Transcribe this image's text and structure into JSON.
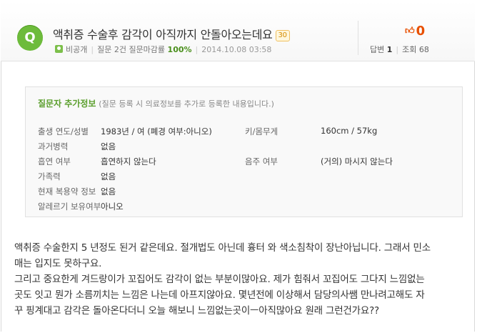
{
  "question": {
    "badge": "Q",
    "title": "액취증 수술후 감각이 아직까지 안돌아오는데요",
    "points": "30",
    "author": "비공개",
    "stats_text": "질문 2건 질문마감률",
    "close_rate": "100%",
    "date": "2014.10.08 03:58"
  },
  "stats": {
    "like_count": "0",
    "answers_label": "답변",
    "answers": "1",
    "views_label": "조회",
    "views": "68"
  },
  "info": {
    "title": "질문자 추가정보",
    "title_desc": "(질문 등록 시 의료정보를 추가로 등록한 내용입니다.)",
    "rows": [
      {
        "label": "출생 연도/성별",
        "value": "1983년 / 여 (폐경 여부:아니오)",
        "label2": "키/몸무게",
        "value2": "160cm / 57kg"
      },
      {
        "label": "과거병력",
        "value": "없음",
        "label2": "",
        "value2": ""
      },
      {
        "label": "흡연 여부",
        "value": "흡연하지 않는다",
        "label2": "음주 여부",
        "value2": "(거의) 마시지 않는다"
      },
      {
        "label": "가족력",
        "value": "없음",
        "label2": "",
        "value2": ""
      },
      {
        "label": "현재 복용약 정보",
        "value": "없음",
        "label2": "",
        "value2": ""
      },
      {
        "label": "알레르기 보유여부",
        "value": "아니오",
        "label2": "",
        "value2": ""
      }
    ]
  },
  "body": [
    "액취증 수술한지 5 년정도 된거 같은데요. 절개법도 아닌데 흉터 와 색소침착이 장난아닙니다. 그래서 민소",
    "매는 입지도 못하구요.",
    "그리고 중요한게 겨드랑이가 꼬집어도 감각이 없는 부분이많아요. 제가 힘줘서 꼬집어도 그다지 느낌없는",
    "곳도 잇고 뭔가 소름끼치는 느낌은 나는데 아프지않아요. 몇년전에 이상해서 담당의사쌤 만나려고해도 자",
    "꾸 핑계대고 감각은 돌아온다더니 오늘 해보니 느낌없는곳이ㅡ아직많아요 원래 그런건가요??"
  ]
}
